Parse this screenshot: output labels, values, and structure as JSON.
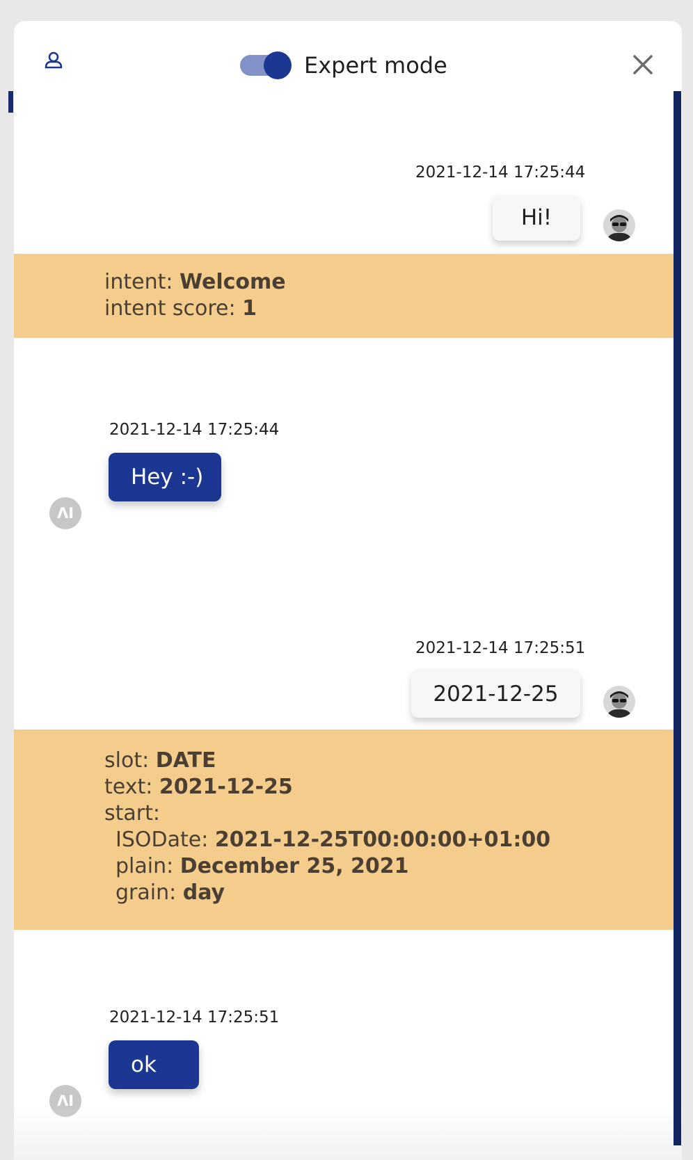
{
  "header": {
    "toggle_label": "Expert mode",
    "toggle_on": true
  },
  "messages": [
    {
      "sender": "user",
      "timestamp": "2021-12-14 17:25:44",
      "text": "Hi!"
    },
    {
      "sender": "bot",
      "timestamp": "2021-12-14 17:25:44",
      "text": "Hey :-)",
      "avatar_text": "ΛI"
    },
    {
      "sender": "user",
      "timestamp": "2021-12-14 17:25:51",
      "text": "2021-12-25"
    },
    {
      "sender": "bot",
      "timestamp": "2021-12-14 17:25:51",
      "text": "ok",
      "avatar_text": "ΛI"
    }
  ],
  "debug": {
    "intent_block": {
      "intent_key": "intent:",
      "intent_value": "Welcome",
      "score_key": "intent score:",
      "score_value": "1"
    },
    "slot_block": {
      "slot_key": "slot:",
      "slot_value": "DATE",
      "text_key": "text:",
      "text_value": "2021-12-25",
      "start_key": "start:",
      "isodate_key": "ISODate:",
      "isodate_value": "2021-12-25T00:00:00+01:00",
      "plain_key": "plain:",
      "plain_value": "December 25, 2021",
      "grain_key": "grain:",
      "grain_value": "day"
    }
  },
  "colors": {
    "brand_blue": "#1c3791",
    "debug_bg": "#f4cd8c",
    "scroll_rail": "#14245e"
  }
}
